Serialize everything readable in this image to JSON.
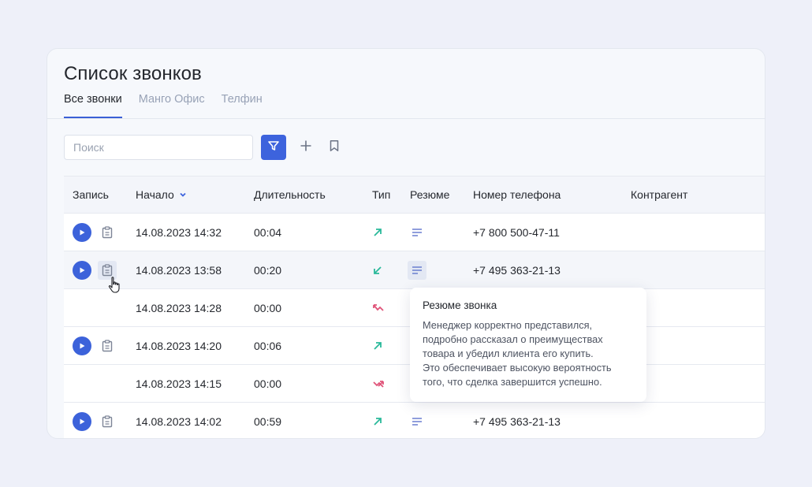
{
  "page": {
    "title": "Список звонков"
  },
  "tabs": [
    {
      "label": "Все звонки",
      "active": true
    },
    {
      "label": "Манго Офис",
      "active": false
    },
    {
      "label": "Телфин",
      "active": false
    }
  ],
  "toolbar": {
    "search_placeholder": "Поиск",
    "filter_icon": "filter-icon",
    "add_icon": "plus-icon",
    "bookmark_icon": "bookmark-icon"
  },
  "table": {
    "columns": {
      "record": "Запись",
      "start": "Начало",
      "duration": "Длительность",
      "type": "Тип",
      "summary": "Резюме",
      "phone": "Номер телефона",
      "counterparty": "Контрагент"
    },
    "sort": {
      "column": "start",
      "direction": "desc"
    },
    "rows": [
      {
        "start": "14.08.2023 14:32",
        "duration": "00:04",
        "type": "outgoing",
        "phone": "+7 800 500-47-11",
        "has_record": true,
        "has_summary": true
      },
      {
        "start": "14.08.2023 13:58",
        "duration": "00:20",
        "type": "incoming",
        "phone": "+7 495 363-21-13",
        "has_record": true,
        "has_summary": true
      },
      {
        "start": "14.08.2023 14:28",
        "duration": "00:00",
        "type": "missed-incoming",
        "phone": "",
        "has_record": false,
        "has_summary": false
      },
      {
        "start": "14.08.2023 14:20",
        "duration": "00:06",
        "type": "outgoing",
        "phone": "",
        "has_record": true,
        "has_summary": false
      },
      {
        "start": "14.08.2023 14:15",
        "duration": "00:00",
        "type": "missed-outgoing",
        "phone": "",
        "has_record": false,
        "has_summary": false
      },
      {
        "start": "14.08.2023 14:02",
        "duration": "00:59",
        "type": "outgoing",
        "phone": "+7 495 363-21-13",
        "has_record": true,
        "has_summary": true
      }
    ]
  },
  "tooltip": {
    "title": "Резюме звонка",
    "lines": [
      "Менеджер корректно представился,",
      "подробно рассказал о преимуществах",
      "товара и убедил клиента его купить.",
      "Это обеспечивает высокую вероятность",
      "того, что сделка завершится успешно."
    ]
  },
  "colors": {
    "accent": "#3d63dd",
    "outgoing": "#2ab99a",
    "missed": "#e0557a",
    "icon_gray": "#7d8597"
  }
}
